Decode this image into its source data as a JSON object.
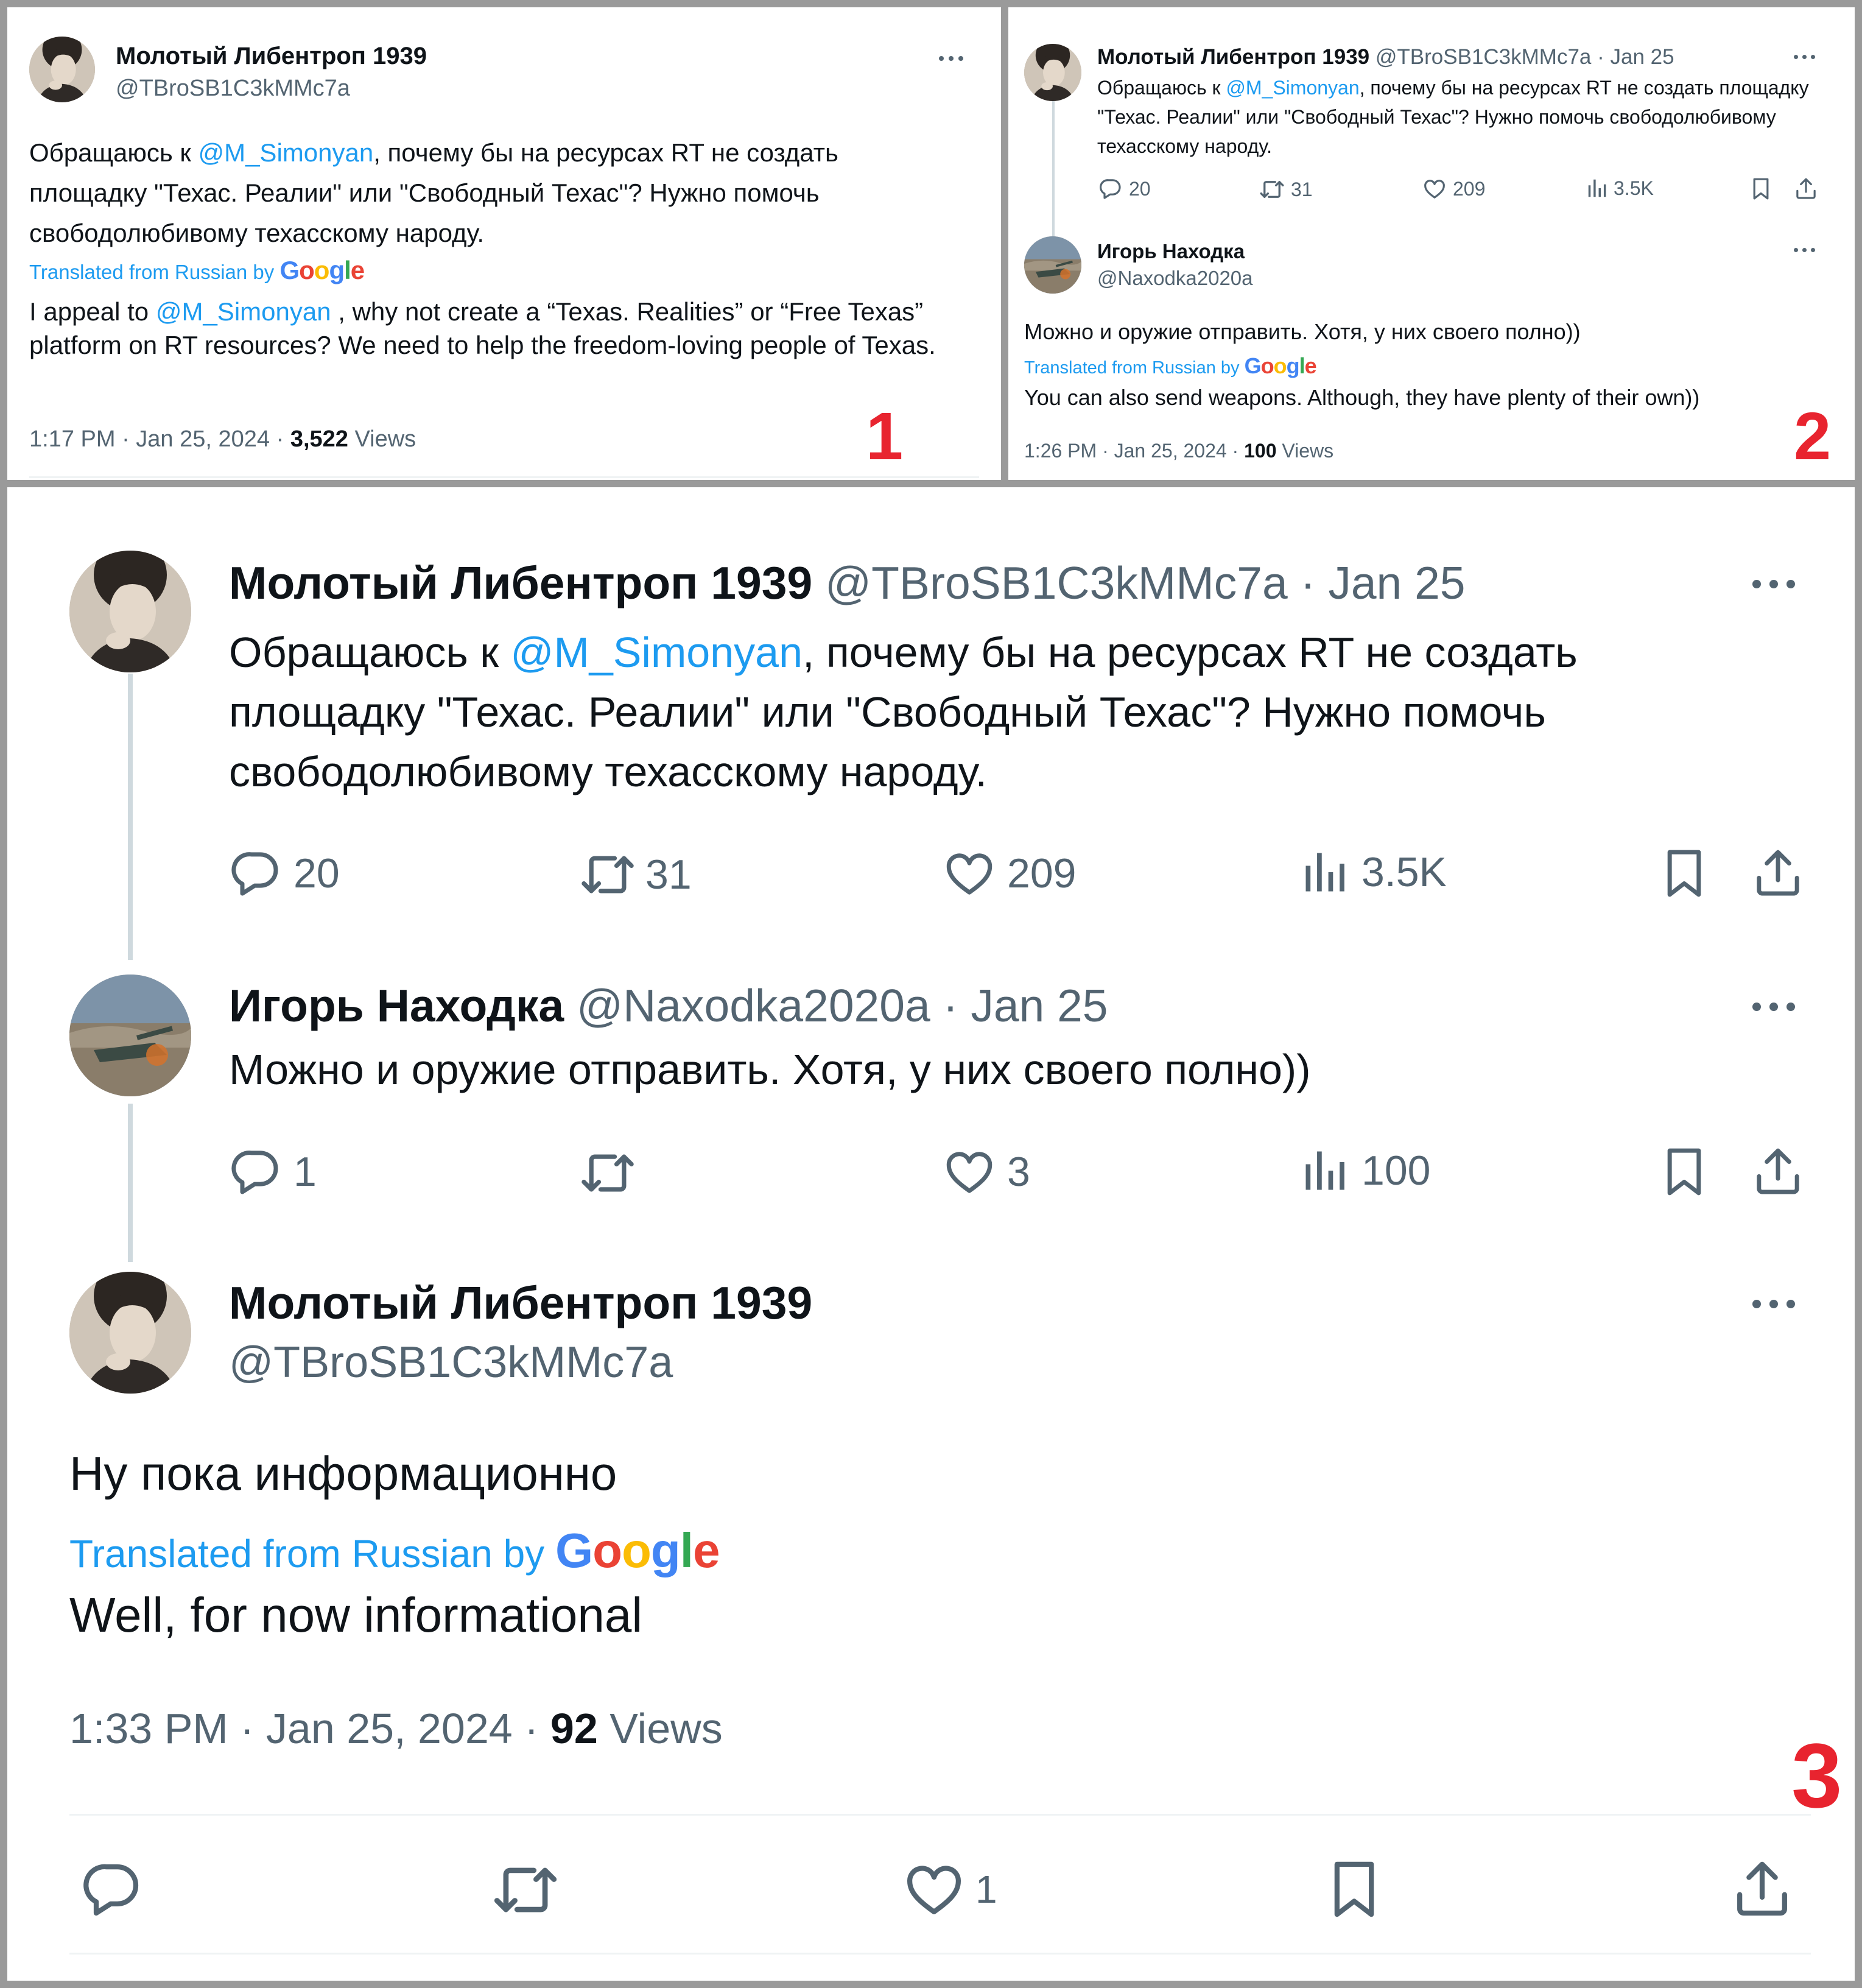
{
  "colors": {
    "accent": "#1d9bf0",
    "panel_number": "#e8242f",
    "text": "#0f1419",
    "muted": "#536471"
  },
  "panel1": {
    "number": "1",
    "author_name": "Молотый Либентроп 1939",
    "author_handle": "@TBroSB1C3kMMc7a",
    "text_before": "Обращаюсь к ",
    "mention": "@M_Simonyan",
    "text_after": ", почему бы на ресурсах RT не создать площадку \"Техас. Реалии\" или \"Свободный Техас\"? Нужно помочь свободолюбивому техасскому народу.",
    "translated_label": "Translated from Russian by",
    "google": [
      "G",
      "o",
      "o",
      "g",
      "l",
      "e"
    ],
    "tr_before": "I appeal to ",
    "tr_mention": "@M_Simonyan",
    "tr_after": " , why not create a “Texas. Realities” or “Free Texas” platform on RT resources? We need to help the freedom-loving people of Texas.",
    "timestamp": "1:17 PM · Jan 25, 2024 · ",
    "views_count": "3,522",
    "views_label": " Views"
  },
  "panel2": {
    "number": "2",
    "tweet1": {
      "author_name": "Молотый Либентроп 1939",
      "author_handle": "@TBroSB1C3kMMc7a",
      "date": " · Jan 25",
      "text_before": "Обращаюсь к ",
      "mention": "@M_Simonyan",
      "text_after": ", почему бы на ресурсах RT не создать площадку \"Техас. Реалии\" или \"Свободный Техас\"? Нужно помочь свободолюбивому техасскому народу.",
      "replies": "20",
      "reposts": "31",
      "likes": "209",
      "views": "3.5K"
    },
    "tweet2": {
      "author_name": "Игорь Находка",
      "author_handle": "@Naxodka2020a",
      "text": "Можно и оружие отправить. Хотя, у них своего полно))",
      "translated_label": "Translated from Russian by",
      "translation": "You can also send weapons. Although, they have plenty of their own))",
      "timestamp": "1:26 PM · Jan 25, 2024 · ",
      "views_count": "100",
      "views_label": " Views"
    }
  },
  "panel3": {
    "number": "3",
    "tweet1": {
      "author_name": "Молотый Либентроп 1939",
      "author_handle": "@TBroSB1C3kMMc7a",
      "date": " · Jan 25",
      "text_before": "Обращаюсь к ",
      "mention": "@M_Simonyan",
      "text_after": ", почему бы на ресурсах RT не создать площадку \"Техас. Реалии\" или \"Свободный Техас\"? Нужно помочь свободолюбивому техасскому народу.",
      "replies": "20",
      "reposts": "31",
      "likes": "209",
      "views": "3.5K"
    },
    "tweet2": {
      "author_name": "Игорь Находка",
      "author_handle": "@Naxodka2020a",
      "date": " · Jan 25",
      "text": "Можно и оружие отправить. Хотя, у них своего полно))",
      "replies": "1",
      "reposts": "",
      "likes": "3",
      "views": "100"
    },
    "tweet3": {
      "author_name": "Молотый Либентроп 1939",
      "author_handle": "@TBroSB1C3kMMc7a",
      "text": "Ну пока информационно",
      "translated_label": "Translated from Russian by",
      "translation": "Well, for now informational",
      "timestamp": "1:33 PM · Jan 25, 2024 · ",
      "views_count": "92",
      "views_label": " Views",
      "likes": "1"
    }
  }
}
